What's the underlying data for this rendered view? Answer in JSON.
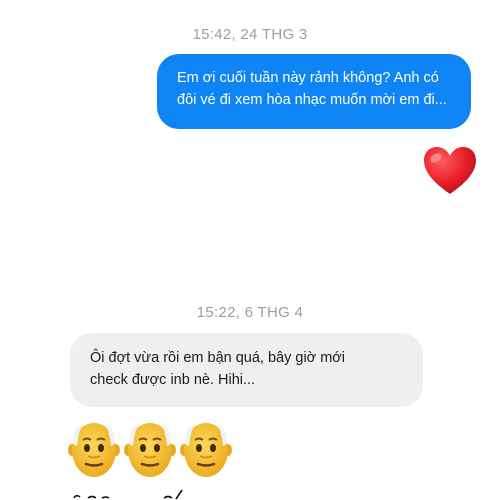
{
  "messages": {
    "timestamp_1": "15:42, 24 THG 3",
    "outgoing": {
      "line_1": "Em ơi cuối tuần này rảnh không? Anh có",
      "line_2": "đôi vé đi xem hòa nhạc muốn mời em đi..."
    },
    "outgoing_reaction_icon": "red-heart",
    "timestamp_2": "15:22, 6 THG 4",
    "incoming": {
      "line_1": "Ôi đợt vừa rồi em bận quá, bây giờ mới",
      "line_2": "check được inb nè. Hihi..."
    },
    "incoming_reaction_icons": [
      "older-man",
      "older-man",
      "older-man"
    ]
  },
  "colors": {
    "outgoing_bubble": "#0f84f4",
    "incoming_bubble": "#efeff0",
    "timestamp_text": "#9a9ea4",
    "heart": "#e8202a"
  }
}
